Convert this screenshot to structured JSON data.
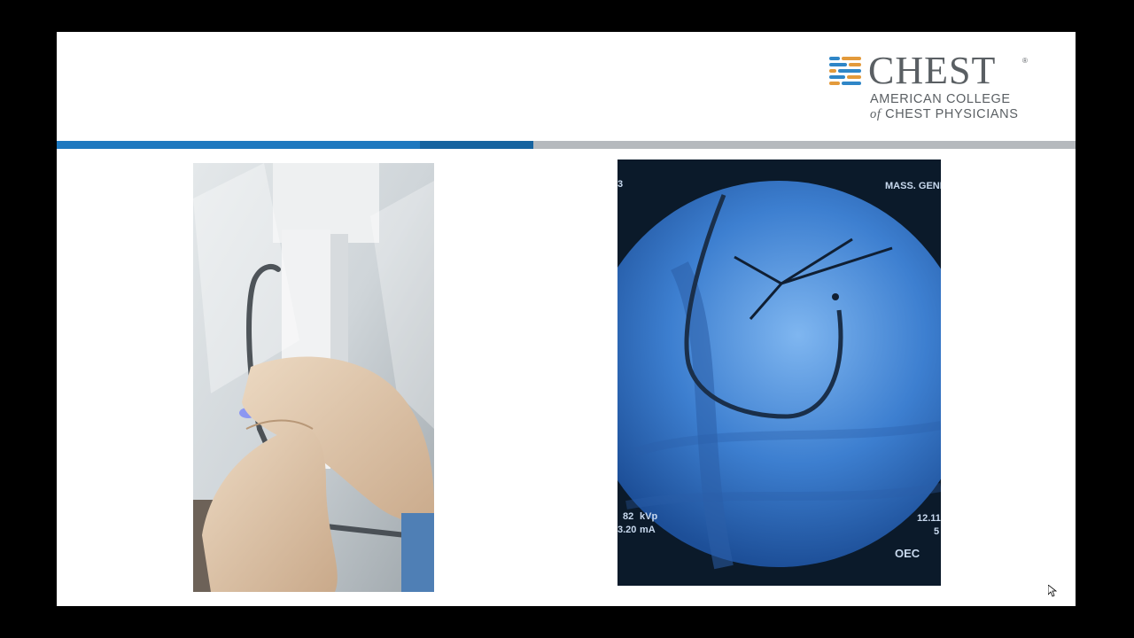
{
  "logo": {
    "wordmark": "CHEST",
    "registered": "®",
    "subtitle_line1": "AMERICAN COLLEGE",
    "subtitle_of": "of",
    "subtitle_line2": "CHEST PHYSICIANS",
    "colors": {
      "stripe_blue": "#2f86c7",
      "stripe_orange": "#e39a3b",
      "text": "#5a5f63"
    }
  },
  "rule_colors": {
    "blue": "#1d78bf",
    "dark_blue": "#16639f",
    "gray": "#b5b9bd"
  },
  "images": {
    "left_photo": {
      "icon": "photo-gloved-hands-catheter"
    },
    "right_fluoro": {
      "icon": "photo-fluoroscopy",
      "label_top_right": "MASS. GENER",
      "label_top_left": "3",
      "kvp_value": "82",
      "kvp_unit": "kVp",
      "ma_value": "3.20",
      "ma_unit": "mA",
      "right_value_1": "12.11",
      "right_value_2": "5",
      "brand": "OEC"
    }
  }
}
